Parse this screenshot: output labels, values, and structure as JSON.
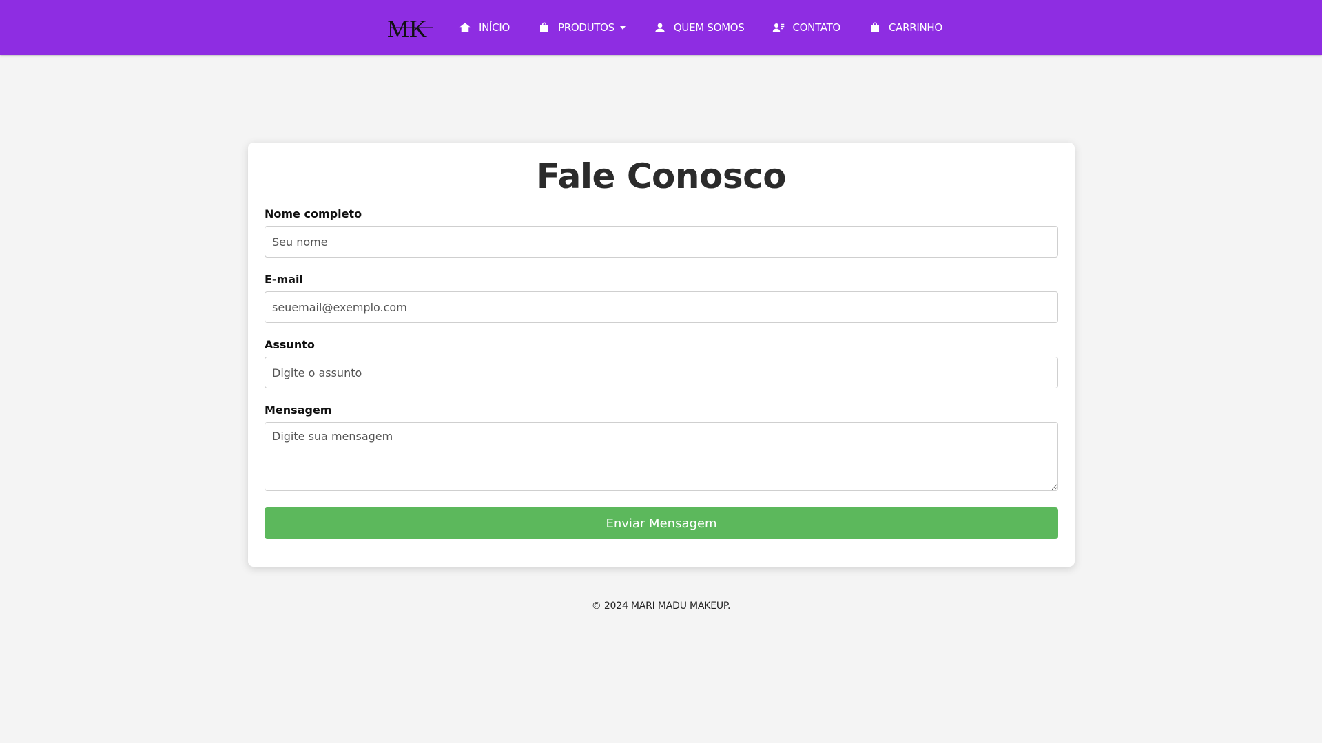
{
  "brand": {
    "logo_text": "MK",
    "primary_color": "#8e2de2"
  },
  "nav": {
    "items": [
      {
        "label": "INÍCIO",
        "icon": "home-icon"
      },
      {
        "label": "PRODUTOS",
        "icon": "shopping-bag-icon",
        "dropdown": true
      },
      {
        "label": "QUEM SOMOS",
        "icon": "user-icon"
      },
      {
        "label": "CONTATO",
        "icon": "contact-card-icon"
      },
      {
        "label": "CARRINHO",
        "icon": "shopping-bag-icon"
      }
    ]
  },
  "form": {
    "title": "Fale Conosco",
    "name": {
      "label": "Nome completo",
      "placeholder": "Seu nome",
      "value": ""
    },
    "email": {
      "label": "E-mail",
      "placeholder": "seuemail@exemplo.com",
      "value": ""
    },
    "subject": {
      "label": "Assunto",
      "placeholder": "Digite o assunto",
      "value": ""
    },
    "message": {
      "label": "Mensagem",
      "placeholder": "Digite sua mensagem",
      "value": ""
    },
    "submit_label": "Enviar Mensagem",
    "submit_color": "#5cb85c"
  },
  "footer": {
    "text": "© 2024 MARI MADU MAKEUP."
  }
}
